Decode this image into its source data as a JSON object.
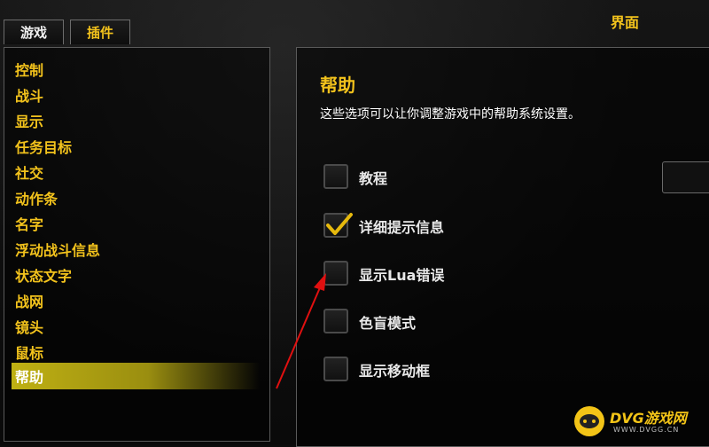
{
  "window": {
    "title": "界面"
  },
  "tabs": [
    {
      "label": "游戏"
    },
    {
      "label": "插件"
    }
  ],
  "categories": [
    {
      "label": "控制"
    },
    {
      "label": "战斗"
    },
    {
      "label": "显示"
    },
    {
      "label": "任务目标"
    },
    {
      "label": "社交"
    },
    {
      "label": "动作条"
    },
    {
      "label": "名字"
    },
    {
      "label": "浮动战斗信息"
    },
    {
      "label": "状态文字"
    },
    {
      "label": "战网"
    },
    {
      "label": "镜头"
    },
    {
      "label": "鼠标"
    },
    {
      "label": "帮助"
    }
  ],
  "selected_category": "帮助",
  "panel": {
    "title": "帮助",
    "description": "这些选项可以让你调整游戏中的帮助系统设置。",
    "options": [
      {
        "label": "教程",
        "checked": false
      },
      {
        "label": "详细提示信息",
        "checked": true
      },
      {
        "label": "显示Lua错误",
        "checked": false
      },
      {
        "label": "色盲模式",
        "checked": false
      },
      {
        "label": "显示移动框",
        "checked": false
      }
    ]
  },
  "watermark": {
    "text": "DVG游戏网",
    "sub": "WWW.DVGG.CN"
  },
  "colors": {
    "accent": "#f2c21c",
    "highlight": "#bfb013",
    "annotation_arrow": "#e01010"
  }
}
